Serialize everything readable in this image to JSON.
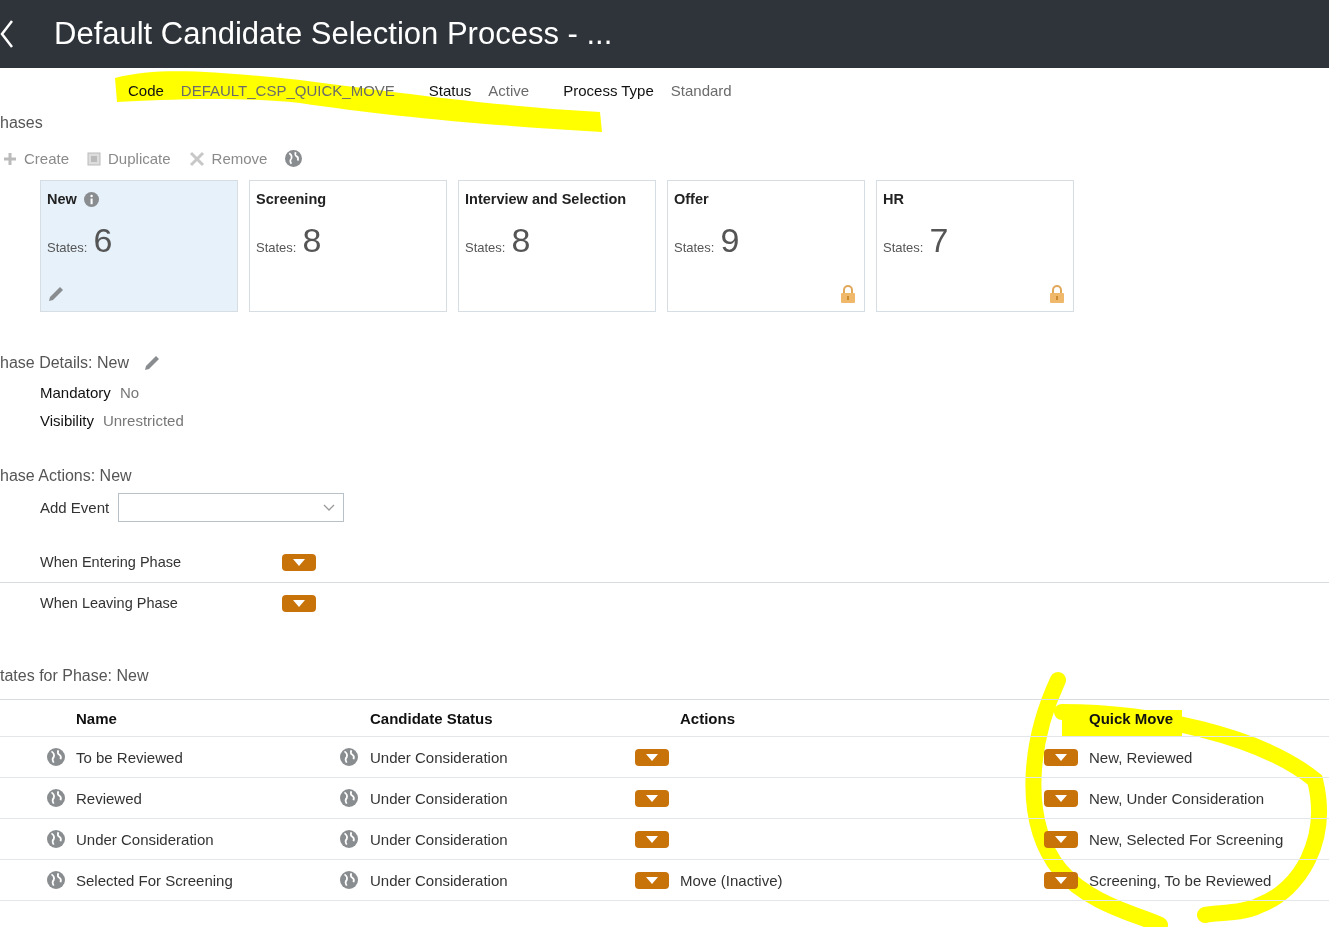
{
  "window": {
    "title": "Default Candidate Selection Process - ..."
  },
  "info": [
    {
      "label": "Code",
      "value": "DEFAULT_CSP_QUICK_MOVE"
    },
    {
      "label": "Status",
      "value": "Active"
    },
    {
      "label": "Process Type",
      "value": "Standard"
    }
  ],
  "phases": {
    "heading": "hases",
    "toolbar": [
      {
        "kind": "plus",
        "label": "Create"
      },
      {
        "kind": "copy",
        "label": "Duplicate"
      },
      {
        "kind": "cross",
        "label": "Remove"
      },
      {
        "kind": "globe"
      }
    ],
    "cards": [
      {
        "name": "New",
        "states_label": "States:",
        "count": "6",
        "selected": true,
        "locked": false
      },
      {
        "name": "Screening",
        "states_label": "States:",
        "count": "8",
        "selected": false,
        "locked": false
      },
      {
        "name": "Interview and Selection",
        "states_label": "States:",
        "count": "8",
        "selected": false,
        "locked": false
      },
      {
        "name": "Offer",
        "states_label": "States:",
        "count": "9",
        "selected": false,
        "locked": true
      },
      {
        "name": "HR",
        "states_label": "States:",
        "count": "7",
        "selected": false,
        "locked": true
      }
    ]
  },
  "details": {
    "heading": "hase Details: New",
    "fields": [
      {
        "label": "Mandatory",
        "value": "No"
      },
      {
        "label": "Visibility",
        "value": "Unrestricted"
      }
    ]
  },
  "actions": {
    "heading": "hase Actions: New",
    "add_event_label": "Add Event",
    "events": [
      {
        "label": "When Entering Phase"
      },
      {
        "label": "When Leaving Phase"
      }
    ]
  },
  "states": {
    "heading": "tates for Phase: New",
    "columns": [
      "Name",
      "Candidate Status",
      "Actions",
      "Quick Move"
    ],
    "rows": [
      {
        "name": "To be Reviewed",
        "status": "Under Consideration",
        "actions": "",
        "quick_move": "New, Reviewed"
      },
      {
        "name": "Reviewed",
        "status": "Under Consideration",
        "actions": "",
        "quick_move": "New, Under Consideration"
      },
      {
        "name": "Under Consideration",
        "status": "Under Consideration",
        "actions": "",
        "quick_move": "New, Selected For Screening"
      },
      {
        "name": "Selected For Screening",
        "status": "Under Consideration",
        "actions": "Move (Inactive)",
        "quick_move": "Screening, To be Reviewed"
      }
    ]
  }
}
